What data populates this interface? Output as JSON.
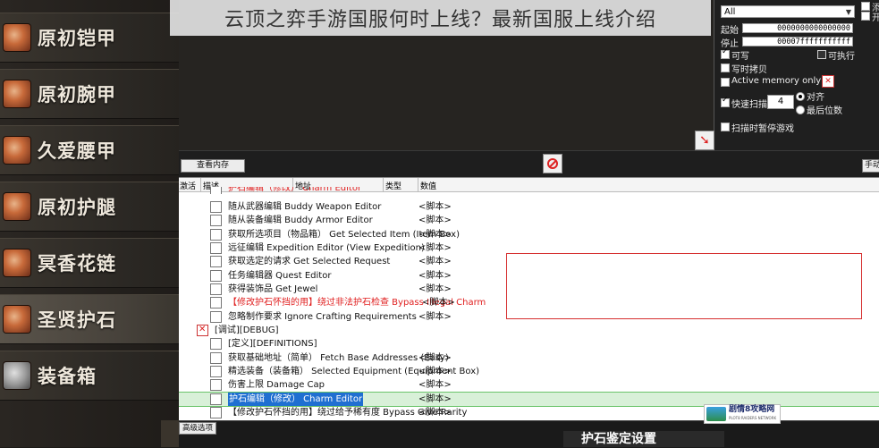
{
  "article_title": "云顶之弈手游国服何时上线？最新国服上线介绍",
  "game_menu": {
    "items": [
      {
        "label": "原初铠甲",
        "selected": false
      },
      {
        "label": "原初腕甲",
        "selected": false
      },
      {
        "label": "久爱腰甲",
        "selected": false
      },
      {
        "label": "原初护腿",
        "selected": false
      },
      {
        "label": "冥香花链",
        "selected": false
      },
      {
        "label": "圣贤护石",
        "selected": true
      },
      {
        "label": "装备箱",
        "selected": false
      }
    ]
  },
  "scan_panel": {
    "value_type": "All",
    "start_label": "起始",
    "start_value": "0000000000000000",
    "stop_label": "停止",
    "stop_value": "00007fffffffffff",
    "writable_label": "可写",
    "writable_checked": true,
    "executable_label": "可执行",
    "executable_checked": false,
    "copy_on_write_label": "写时拷贝",
    "copy_on_write_checked": false,
    "active_memory_label": "Active memory only",
    "active_memory_checked": false,
    "fast_scan_label": "快速扫描",
    "fast_scan_checked": true,
    "fast_scan_value": "4",
    "align_label": "对齐",
    "align_selected": true,
    "last_digit_label": "最后位数",
    "last_digit_selected": false,
    "pause_label": "扫描时暂停游戏",
    "pause_checked": false,
    "right_hint_1": "添",
    "right_hint_2": "开"
  },
  "toolbar": {
    "view_memory_label": "查看内存",
    "manual_add_label": "手动添加",
    "advanced_label": "高级选项"
  },
  "table": {
    "columns": [
      "激活",
      "描述",
      "地址",
      "类型",
      "数值"
    ],
    "rows": [
      {
        "desc": "护石编辑（修改） Charm Editor",
        "value": "",
        "style": "red",
        "partial": true
      },
      {
        "desc": "随从武器编辑 Buddy Weapon Editor",
        "value": "<脚本>",
        "style": "normal"
      },
      {
        "desc": "随从装备编辑 Buddy Armor Editor",
        "value": "<脚本>",
        "style": "normal"
      },
      {
        "desc": "获取所选项目（物品箱） Get Selected Item (Item Box)",
        "value": "<脚本>",
        "style": "normal"
      },
      {
        "desc": "远征编辑 Expedition Editor (View Expedition)",
        "value": "<脚本>",
        "style": "normal"
      },
      {
        "desc": "获取选定的请求 Get Selected Request",
        "value": "<脚本>",
        "style": "normal"
      },
      {
        "desc": "任务编辑器 Quest Editor",
        "value": "<脚本>",
        "style": "normal"
      },
      {
        "desc": "获得装饰品 Get Jewel",
        "value": "<脚本>",
        "style": "normal"
      },
      {
        "desc": "【修改护石怀挡的用】绕过非法护石检查 Bypass Illegal Charm",
        "value": "<脚本>",
        "style": "red"
      },
      {
        "desc": "忽略制作要求 Ignore Crafting Requirements",
        "value": "<脚本>",
        "style": "normal"
      },
      {
        "desc": "[调试][DEBUG]",
        "value": "",
        "style": "debug"
      },
      {
        "desc": "[定义][DEFINITIONS]",
        "value": "",
        "style": "normal"
      },
      {
        "desc": "获取基础地址（简单） Fetch Base Addresses (Easy)",
        "value": "<脚本>",
        "style": "normal"
      },
      {
        "desc": "精选装备（装备箱） Selected Equipment (Equipment Box)",
        "value": "<脚本>",
        "style": "normal"
      },
      {
        "desc": "伤害上限 Damage Cap",
        "value": "<脚本>",
        "style": "normal"
      },
      {
        "desc": "护石编辑（修改） Charm Editor",
        "value": "<脚本>",
        "style": "selected"
      },
      {
        "desc": "【修改护石怀挡的用】绕过给予稀有度 Bypass Give Rarity",
        "value": "<脚本>",
        "style": "normal"
      }
    ]
  },
  "watermark": {
    "name": "剧情8攻略网",
    "sub": "PLOT8 RAIDERS NETWORK"
  },
  "bottom_banner": "护石鉴定设置"
}
